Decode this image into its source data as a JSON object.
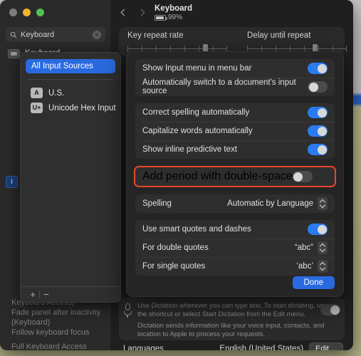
{
  "window": {
    "traffic_lights": [
      "close",
      "minimize",
      "zoom"
    ],
    "search": {
      "value": "Keyboard",
      "placeholder": "Search",
      "clear_label": "✕"
    },
    "sidebar_item": {
      "label": "Keyboard"
    },
    "background_results": [
      "Keyboard Access)",
      "Fade panel after inactivity (Keyboard)",
      "Follow keyboard focus",
      "Full Keyboard Access"
    ],
    "info_badge": "i"
  },
  "header": {
    "back_label": "Back",
    "forward_label": "Forward",
    "title": "Keyboard",
    "battery_percent": "99%"
  },
  "sliders": [
    {
      "label": "Key repeat rate",
      "position_percent": 78,
      "ticks": 8
    },
    {
      "label": "Delay until repeat",
      "position_percent": 66,
      "ticks": 8
    }
  ],
  "input_sources_popover": {
    "selected": "All Input Sources",
    "sources": [
      {
        "badge": "A",
        "name": "U.S."
      },
      {
        "badge": "U+",
        "name": "Unicode Hex Input"
      }
    ],
    "add_label": "+",
    "remove_label": "−"
  },
  "text_sheet": {
    "groups": [
      {
        "rows": [
          {
            "label": "Show Input menu in menu bar",
            "control": "toggle",
            "state": "on"
          },
          {
            "label": "Automatically switch to a document's input source",
            "control": "toggle",
            "state": "off"
          }
        ]
      },
      {
        "rows": [
          {
            "label": "Correct spelling automatically",
            "control": "toggle",
            "state": "on"
          },
          {
            "label": "Capitalize words automatically",
            "control": "toggle",
            "state": "on"
          },
          {
            "label": "Show inline predictive text",
            "control": "toggle",
            "state": "on"
          }
        ]
      }
    ],
    "highlighted_row": {
      "label": "Add period with double-space",
      "control": "toggle",
      "state": "off",
      "highlight_color": "#e8462a"
    },
    "spelling_row": {
      "label": "Spelling",
      "value": "Automatic by Language",
      "control": "stepper"
    },
    "quotes_group": {
      "rows": [
        {
          "label": "Use smart quotes and dashes",
          "control": "toggle",
          "state": "on"
        },
        {
          "label": "For double quotes",
          "value": "“abc”",
          "control": "stepper"
        },
        {
          "label": "For single quotes",
          "value": "‘abc’",
          "control": "stepper"
        }
      ]
    },
    "done_label": "Done"
  },
  "dictation": {
    "paragraph_1": "Use Dictation wherever you can type text. To start dictating, use the shortcut or select Start Dictation from the Edit menu.",
    "paragraph_2": "Dictation sends information like your voice input, contacts, and location to Apple to process your requests.",
    "toggle_state": "off",
    "languages_label": "Languages",
    "languages_value": "English (United States)",
    "edit_label": "Edit…"
  },
  "colors": {
    "accent_blue": "#2a7bf0",
    "highlight_red": "#e8462a",
    "window_bg": "#222222",
    "sheet_bg": "#252525"
  }
}
